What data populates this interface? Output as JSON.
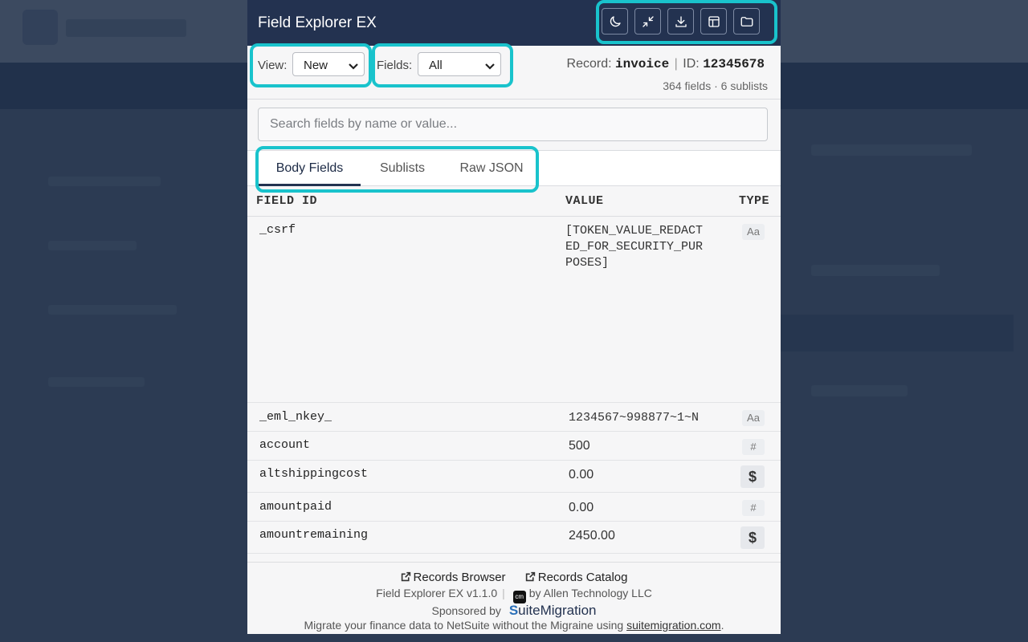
{
  "app": {
    "title": "Field Explorer EX"
  },
  "toolbar": {
    "icons": [
      "moon-icon",
      "collapse-icon",
      "download-icon",
      "layout-icon",
      "folder-icon"
    ]
  },
  "controls": {
    "view_label": "View:",
    "view_value": "New",
    "fields_label": "Fields:",
    "fields_value": "All",
    "record_label": "Record:",
    "record_type": "invoice",
    "id_label": "ID:",
    "record_id": "12345678",
    "counts": "364 fields · 6 sublists"
  },
  "search": {
    "placeholder": "Search fields by name or value..."
  },
  "tabs": [
    {
      "label": "Body Fields",
      "active": true
    },
    {
      "label": "Sublists",
      "active": false
    },
    {
      "label": "Raw JSON",
      "active": false
    }
  ],
  "table": {
    "headers": {
      "field_id": "FIELD ID",
      "value": "VALUE",
      "type": "TYPE"
    },
    "rows": [
      {
        "id": "_csrf",
        "value_lines": [
          "[TOKEN_VALUE_REDACT",
          "ED_FOR_SECURITY_PUR",
          "POSES]"
        ],
        "type": "Aa"
      },
      {
        "id": "_eml_nkey_",
        "value": "1234567~998877~1~N",
        "type": "Aa"
      },
      {
        "id": "account",
        "value": "500",
        "type": "#"
      },
      {
        "id": "altshippingcost",
        "value": "0.00",
        "type": "$"
      },
      {
        "id": "amountpaid",
        "value": "0.00",
        "type": "#"
      },
      {
        "id": "amountremaining",
        "value": "2450.00",
        "type": "$"
      }
    ]
  },
  "footer": {
    "records_browser": "Records Browser",
    "records_catalog": "Records Catalog",
    "version": "Field Explorer EX v1.1.0",
    "cm_logo": "cm",
    "by": "by Allen Technology LLC",
    "sponsored_by": "Sponsored by",
    "sponsor_mark": "S",
    "sponsor_name": "uiteMigration",
    "message_prefix": "Migrate your finance data to NetSuite without the Migraine using ",
    "message_link": "suitemigration.com",
    "message_suffix": "."
  },
  "colors": {
    "header_bg": "#233250",
    "highlight": "#19c3cc"
  }
}
